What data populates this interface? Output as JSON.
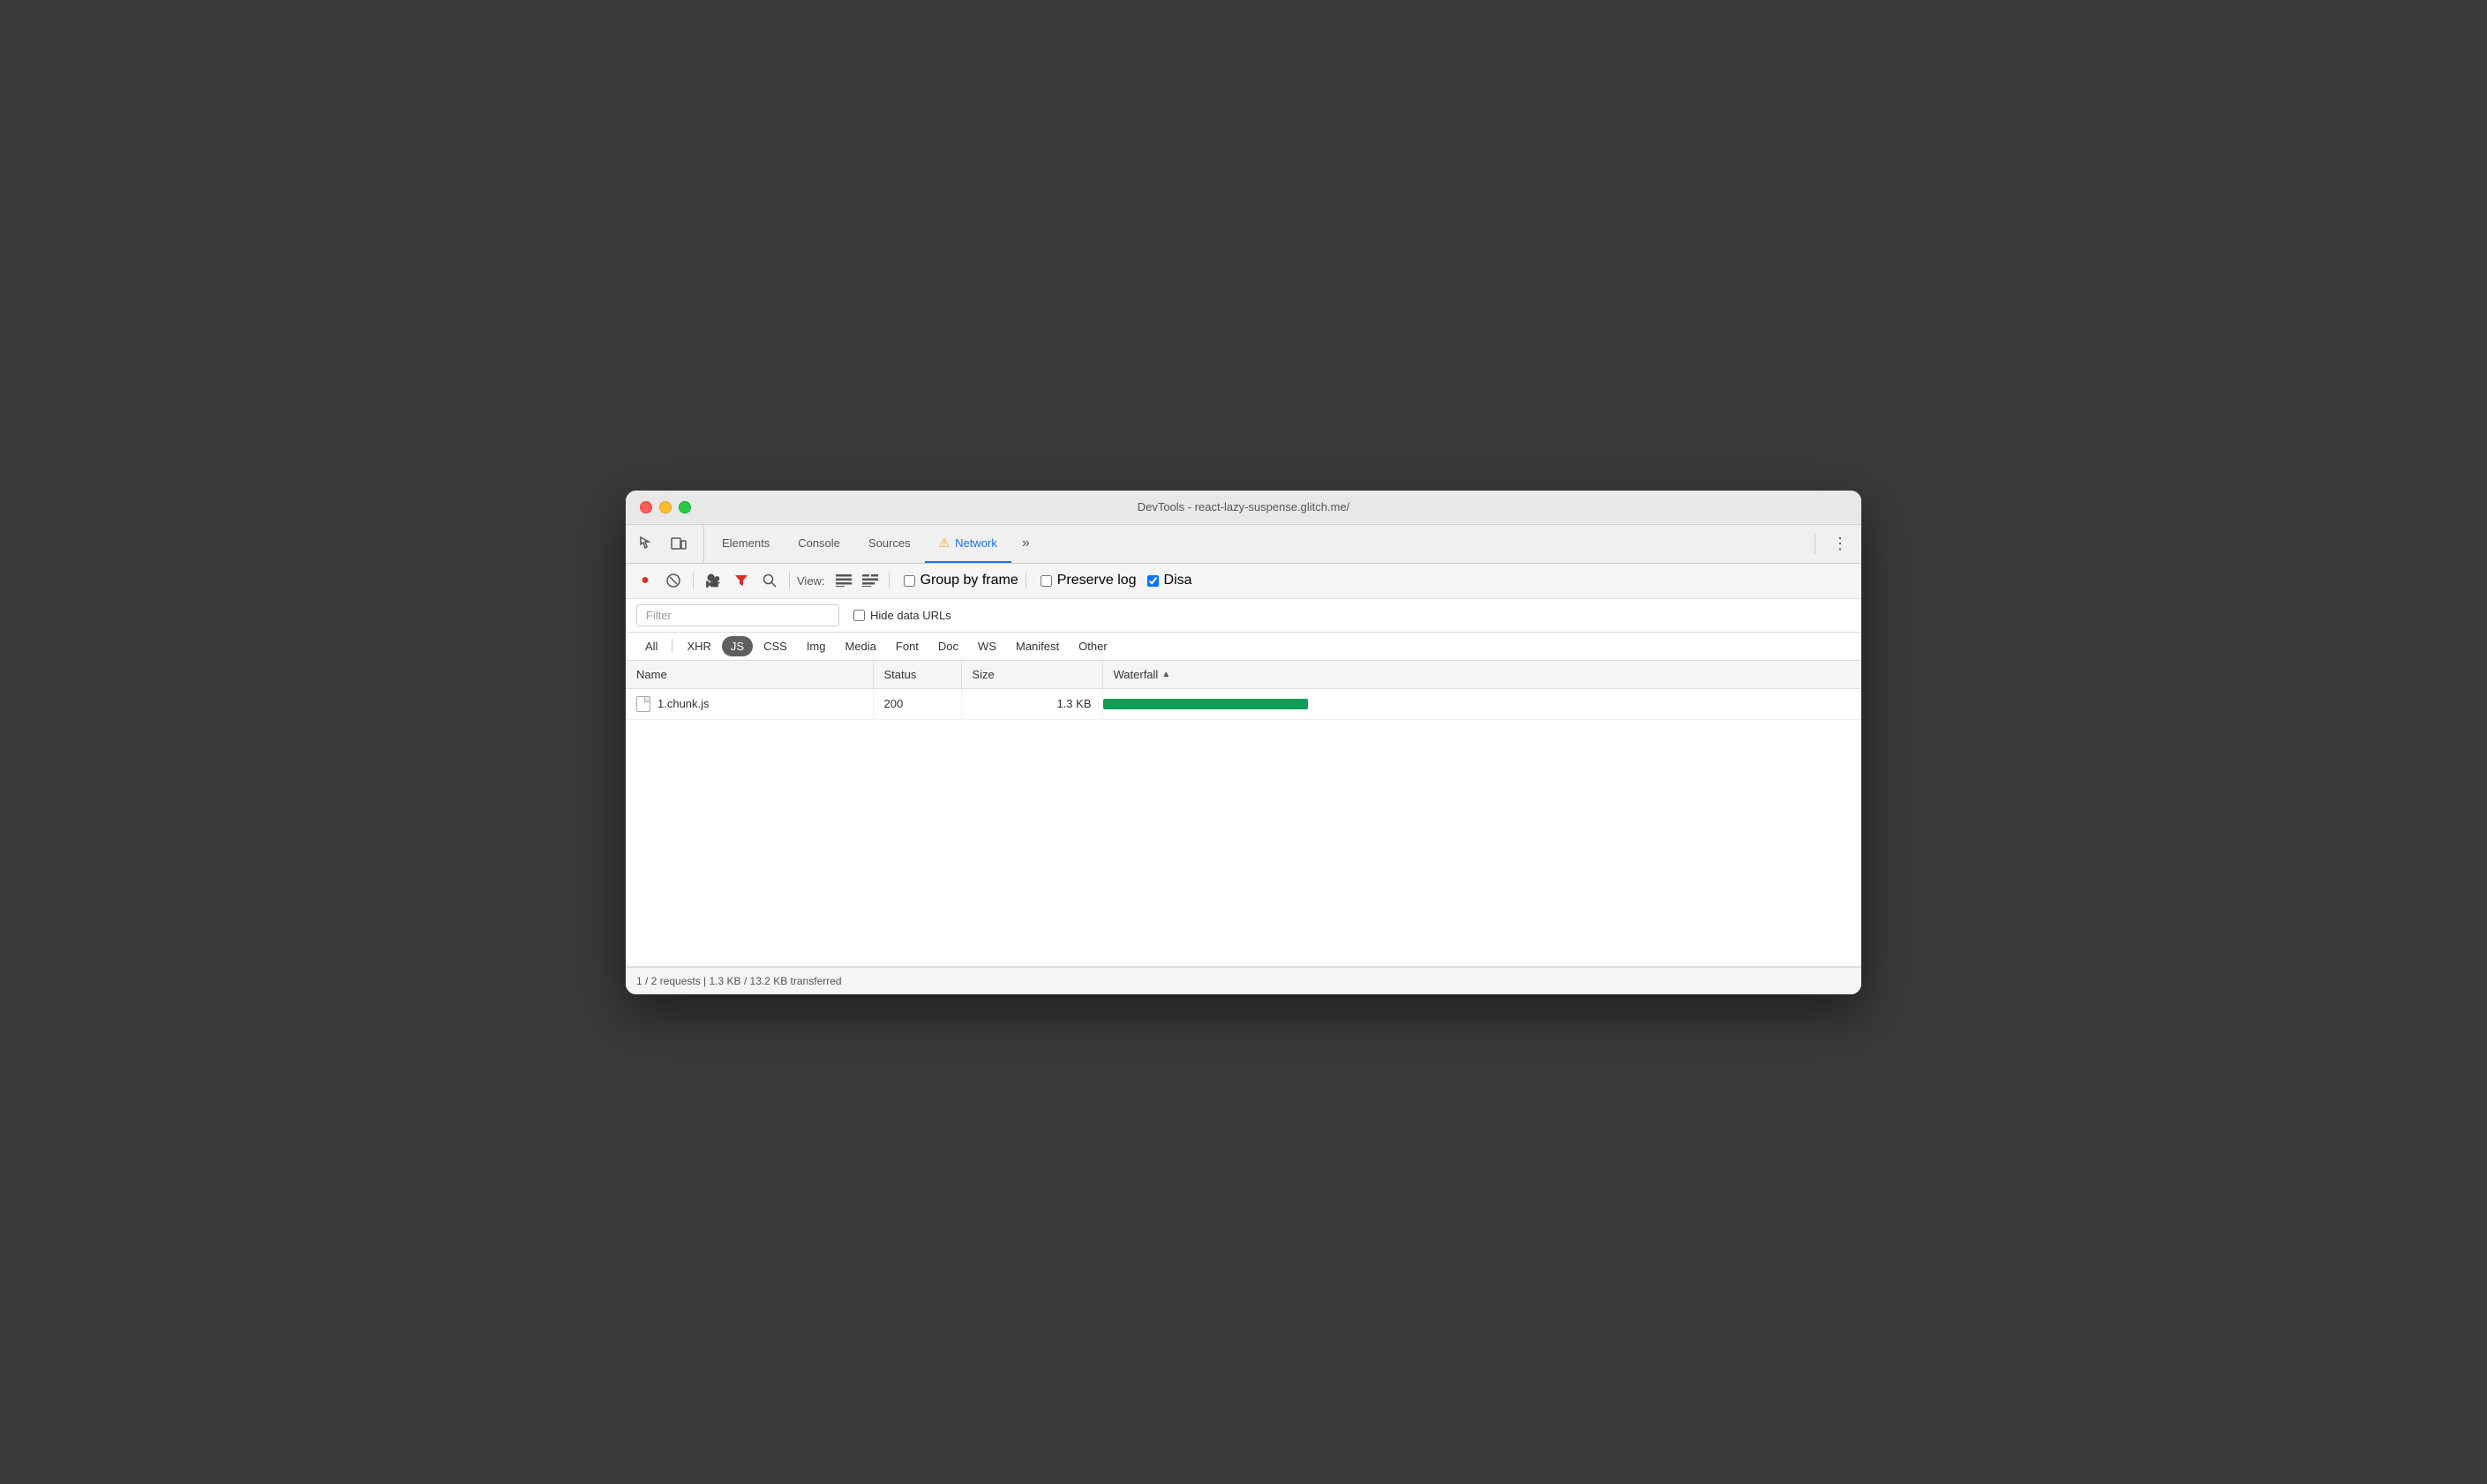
{
  "window": {
    "title": "DevTools - react-lazy-suspense.glitch.me/"
  },
  "traffic_lights": {
    "close": "close",
    "minimize": "minimize",
    "maximize": "maximize"
  },
  "tabs": [
    {
      "id": "elements",
      "label": "Elements",
      "active": false
    },
    {
      "id": "console",
      "label": "Console",
      "active": false
    },
    {
      "id": "sources",
      "label": "Sources",
      "active": false
    },
    {
      "id": "network",
      "label": "Network",
      "active": true,
      "has_warning": true
    },
    {
      "id": "more",
      "label": "»",
      "active": false
    }
  ],
  "toolbar": {
    "record_title": "Record",
    "clear_title": "Clear",
    "camera_title": "Capture screenshot",
    "filter_title": "Filter",
    "search_title": "Search",
    "view_label": "View:",
    "list_view_title": "Use large request rows",
    "group_view_title": "Group by domain",
    "group_by_frame_label": "Group by frame",
    "group_by_frame_checked": false,
    "preserve_log_label": "Preserve log",
    "preserve_log_checked": false,
    "disable_cache_label": "Disa",
    "disable_cache_checked": true
  },
  "filter_bar": {
    "placeholder": "Filter",
    "hide_data_urls_label": "Hide data URLs",
    "hide_data_urls_checked": false
  },
  "type_filters": [
    {
      "id": "all",
      "label": "All",
      "active": false
    },
    {
      "id": "xhr",
      "label": "XHR",
      "active": false
    },
    {
      "id": "js",
      "label": "JS",
      "active": true
    },
    {
      "id": "css",
      "label": "CSS",
      "active": false
    },
    {
      "id": "img",
      "label": "Img",
      "active": false
    },
    {
      "id": "media",
      "label": "Media",
      "active": false
    },
    {
      "id": "font",
      "label": "Font",
      "active": false
    },
    {
      "id": "doc",
      "label": "Doc",
      "active": false
    },
    {
      "id": "ws",
      "label": "WS",
      "active": false
    },
    {
      "id": "manifest",
      "label": "Manifest",
      "active": false
    },
    {
      "id": "other",
      "label": "Other",
      "active": false
    }
  ],
  "table": {
    "columns": [
      {
        "id": "name",
        "label": "Name"
      },
      {
        "id": "status",
        "label": "Status"
      },
      {
        "id": "size",
        "label": "Size"
      },
      {
        "id": "waterfall",
        "label": "Waterfall"
      }
    ],
    "rows": [
      {
        "name": "1.chunk.js",
        "status": "200",
        "size": "1.3 KB",
        "waterfall_left_pct": 0,
        "waterfall_width_pct": 27
      }
    ]
  },
  "status_bar": {
    "text": "1 / 2 requests | 1.3 KB / 13.2 KB transferred"
  }
}
